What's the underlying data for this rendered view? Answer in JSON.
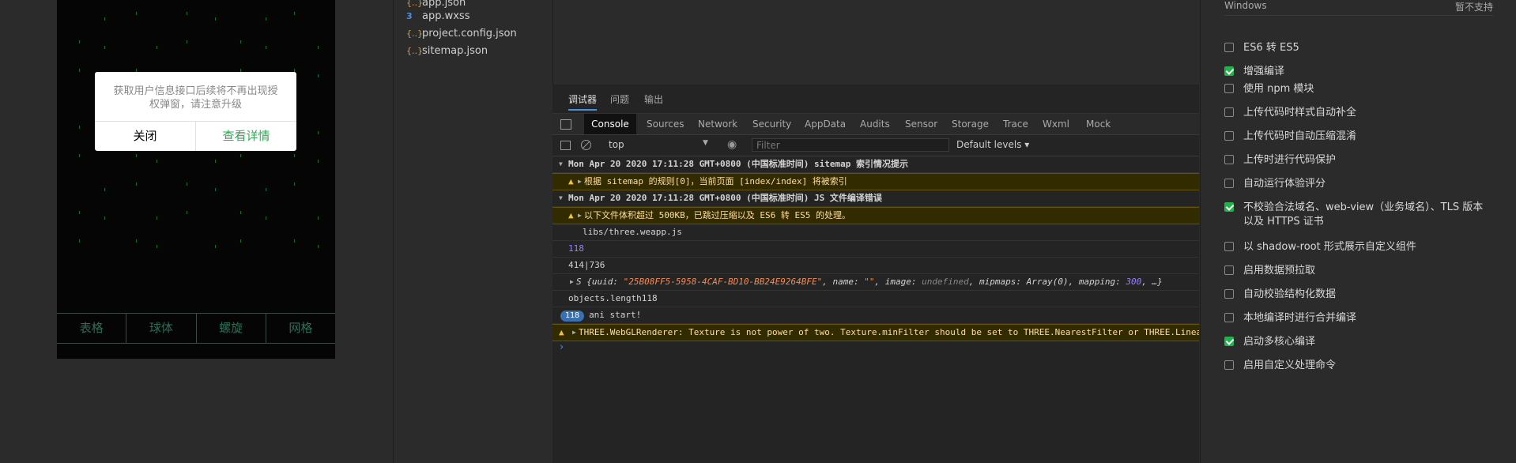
{
  "simulator": {
    "modal": {
      "message": "获取用户信息接口后续将不再出现授权弹窗，请注意升级",
      "cancel": "关闭",
      "confirm": "查看详情"
    },
    "tabs": [
      "表格",
      "球体",
      "螺旋",
      "网格"
    ]
  },
  "file_tree": {
    "files": [
      {
        "name": "app.json",
        "icon": "json-icon"
      },
      {
        "name": "app.wxss",
        "icon": "css-icon"
      },
      {
        "name": "project.config.json",
        "icon": "json-icon"
      },
      {
        "name": "sitemap.json",
        "icon": "json-icon"
      }
    ]
  },
  "debugger": {
    "top_tabs": [
      "调试器",
      "问题",
      "输出"
    ],
    "panel_tabs": [
      "Console",
      "Sources",
      "Network",
      "Security",
      "AppData",
      "Audits",
      "Sensor",
      "Storage",
      "Trace",
      "Wxml",
      "Mock"
    ],
    "context": "top",
    "filter_placeholder": "Filter",
    "levels": "Default levels ▾",
    "console": {
      "group1": "Mon Apr 20 2020 17:11:28 GMT+0800 (中国标准时间) sitemap 索引情况提示",
      "warn1": "根据 sitemap 的规则[0]，当前页面 [index/index] 将被索引",
      "group2": "Mon Apr 20 2020 17:11:28 GMT+0800 (中国标准时间) JS 文件编译错误",
      "warn2": "以下文件体积超过 500KB，已跳过压缩以及 ES6 转 ES5 的处理。",
      "file": "libs/three.weapp.js",
      "n118": "118",
      "size": "414|736",
      "obj_prefix": "S {uuid: ",
      "obj_uuid": "\"25B08FF5-5958-4CAF-BD10-BB24E9264BFE\"",
      "obj_name_key": ", name: ",
      "obj_name_val": "\"\"",
      "obj_image_key": ", image: ",
      "obj_image_val": "undefined",
      "obj_mip_key": ", mipmaps: ",
      "obj_mip_val": "Array(0)",
      "obj_map_key": ", mapping: ",
      "obj_map_val": "300",
      "obj_end": ", …}",
      "objects_len": "objects.length118",
      "badge": "118",
      "ani": "ani start!",
      "webgl_warn": "THREE.WebGLRenderer: Texture is not power of two. Texture.minFilter should be set to THREE.NearestFilter or THREE.Linea"
    }
  },
  "settings": {
    "os_label": "Windows",
    "os_status": "暂不支持",
    "options": [
      {
        "label": "ES6 转 ES5",
        "checked": false
      },
      {
        "label": "增强编译",
        "checked": true
      },
      {
        "label": "使用 npm 模块",
        "checked": false
      },
      {
        "label": "上传代码时样式自动补全",
        "checked": false
      },
      {
        "label": "上传代码时自动压缩混淆",
        "checked": false
      },
      {
        "label": "上传时进行代码保护",
        "checked": false
      },
      {
        "label": "自动运行体验评分",
        "checked": false
      },
      {
        "label": "不校验合法域名、web-view（业务域名）、TLS 版本以及 HTTPS 证书",
        "checked": true
      },
      {
        "label": "以 shadow-root 形式展示自定义组件",
        "checked": false
      },
      {
        "label": "启用数据预拉取",
        "checked": false
      },
      {
        "label": "自动校验结构化数据",
        "checked": false
      },
      {
        "label": "本地编译时进行合并编译",
        "checked": false
      },
      {
        "label": "启动多核心编译",
        "checked": true
      },
      {
        "label": "启用自定义处理命令",
        "checked": false
      }
    ]
  }
}
